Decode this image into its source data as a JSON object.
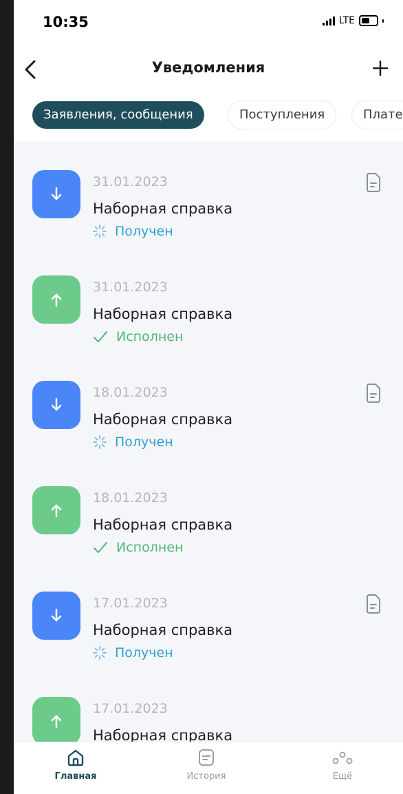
{
  "status_bar": {
    "time": "10:35",
    "network": "LTE"
  },
  "header": {
    "title": "Уведомления",
    "back_icon": "chevron-left-icon",
    "add_icon": "plus-icon"
  },
  "tabs": [
    {
      "label": "Заявления, сообщения",
      "active": true
    },
    {
      "label": "Поступления",
      "active": false
    },
    {
      "label": "Плате",
      "active": false
    }
  ],
  "notifications": [
    {
      "date": "31.01.2023",
      "title": "Наборная справка",
      "status": "Получен",
      "kind": "incoming",
      "has_document": true
    },
    {
      "date": "31.01.2023",
      "title": "Наборная справка",
      "status": "Исполнен",
      "kind": "outgoing",
      "has_document": false
    },
    {
      "date": "18.01.2023",
      "title": "Наборная справка",
      "status": "Получен",
      "kind": "incoming",
      "has_document": true
    },
    {
      "date": "18.01.2023",
      "title": "Наборная справка",
      "status": "Исполнен",
      "kind": "outgoing",
      "has_document": false
    },
    {
      "date": "17.01.2023",
      "title": "Наборная справка",
      "status": "Получен",
      "kind": "incoming",
      "has_document": true
    },
    {
      "date": "17.01.2023",
      "title": "Наборная справка",
      "status": "",
      "kind": "outgoing",
      "has_document": false
    }
  ],
  "bottom_nav": [
    {
      "label": "Главная",
      "icon": "home-icon",
      "active": true
    },
    {
      "label": "История",
      "icon": "history-icon",
      "active": false
    },
    {
      "label": "Ещё",
      "icon": "more-icon",
      "active": false
    }
  ],
  "colors": {
    "accent": "#1f4d5b",
    "incoming": "#4a86f7",
    "outgoing": "#6ccb8a",
    "received_text": "#2e9ed6",
    "done_text": "#50b874"
  }
}
